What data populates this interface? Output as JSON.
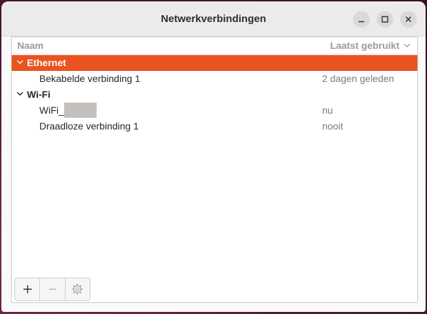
{
  "window": {
    "title": "Netwerkverbindingen"
  },
  "columns": {
    "name": "Naam",
    "last_used": "Laatst gebruikt"
  },
  "groups": [
    {
      "label": "Ethernet",
      "selected": true,
      "items": [
        {
          "name": "Bekabelde verbinding 1",
          "last_used": "2 dagen geleden"
        }
      ]
    },
    {
      "label": "Wi-Fi",
      "selected": false,
      "items": [
        {
          "name": "WiFi_",
          "last_used": "nu",
          "redacted": true
        },
        {
          "name": "Draadloze verbinding 1",
          "last_used": "nooit"
        }
      ]
    }
  ],
  "toolbar": {
    "add": "+",
    "remove": "−",
    "settings_icon": "gear-icon"
  },
  "colors": {
    "accent": "#E95420",
    "titlebar": "#EBEBEB"
  }
}
